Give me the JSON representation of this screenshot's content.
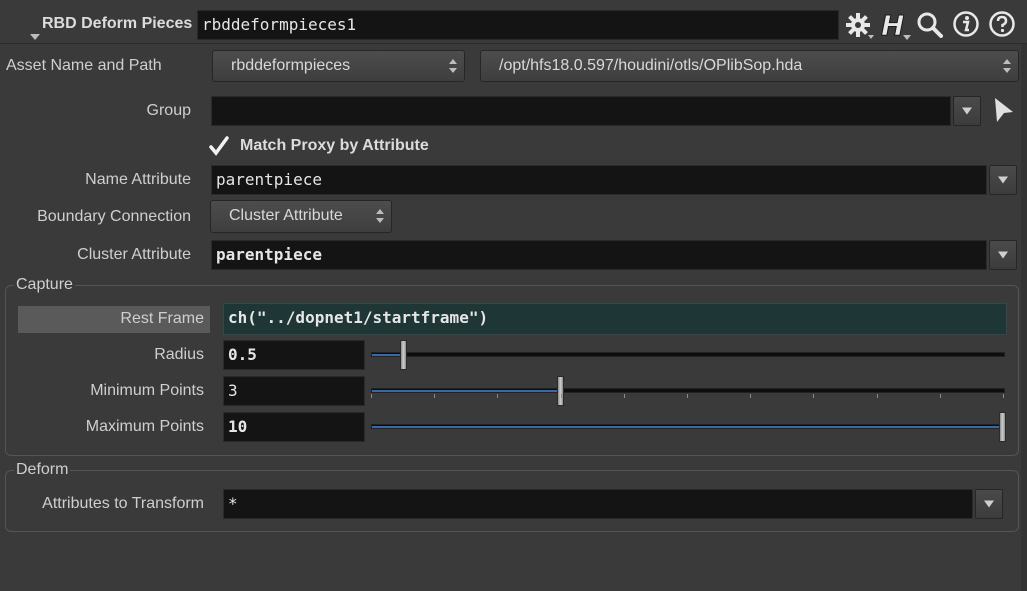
{
  "header": {
    "node_type": "RBD Deform Pieces",
    "node_name": "rbddeformpieces1"
  },
  "asset": {
    "label": "Asset Name and Path",
    "name": "rbddeformpieces",
    "path": "/opt/hfs18.0.597/houdini/otls/OPlibSop.hda"
  },
  "params": {
    "group_label": "Group",
    "group_value": "",
    "match_proxy_label": "Match Proxy by Attribute",
    "match_proxy_checked": true,
    "name_attr_label": "Name Attribute",
    "name_attr_value": "parentpiece",
    "boundary_label": "Boundary Connection",
    "boundary_value": "Cluster Attribute",
    "cluster_label": "Cluster Attribute",
    "cluster_value": "parentpiece"
  },
  "capture": {
    "title": "Capture",
    "rest_frame_label": "Rest Frame",
    "rest_frame_value": "ch(\"../dopnet1/startframe\")",
    "radius_label": "Radius",
    "radius_value": "0.5",
    "radius_fraction": 0.05,
    "min_points_label": "Minimum Points",
    "min_points_value": "3",
    "min_points_fraction": 0.3,
    "max_points_label": "Maximum Points",
    "max_points_value": "10",
    "max_points_fraction": 1.0
  },
  "deform": {
    "title": "Deform",
    "attrs_label": "Attributes to Transform",
    "attrs_value": "*"
  },
  "icons": [
    "gear-icon",
    "houdini-help-icon",
    "search-icon",
    "info-icon",
    "help-icon"
  ],
  "colors": {
    "background": "#3a3a3a",
    "field": "#141414",
    "expression_field": "#1f3636",
    "slider_fill": "#3a68a8"
  }
}
